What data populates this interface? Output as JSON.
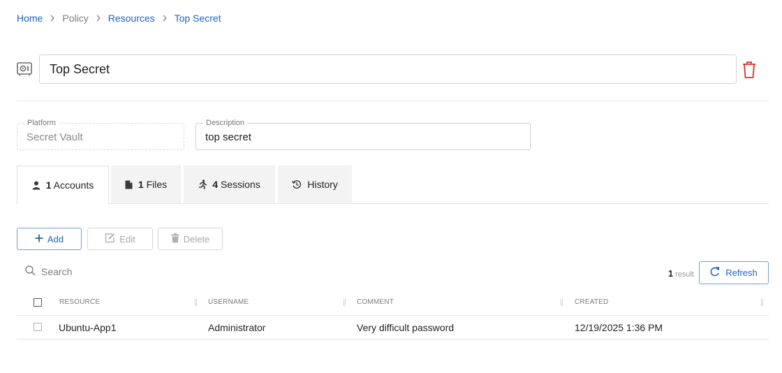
{
  "breadcrumb": {
    "items": [
      "Home",
      "Policy",
      "Resources",
      "Top Secret"
    ]
  },
  "header": {
    "title": "Top Secret",
    "icon": "vault-icon",
    "delete_icon": "trash-icon"
  },
  "fields": {
    "platform": {
      "label": "Platform",
      "value": "Secret Vault"
    },
    "description": {
      "label": "Description",
      "value": "top secret"
    }
  },
  "tabs": [
    {
      "count": "1",
      "label": "Accounts",
      "icon": "user-icon",
      "active": true
    },
    {
      "count": "1",
      "label": "Files",
      "icon": "file-icon",
      "active": false
    },
    {
      "count": "4",
      "label": "Sessions",
      "icon": "running-person-icon",
      "active": false
    },
    {
      "count": "",
      "label": "History",
      "icon": "history-icon",
      "active": false
    }
  ],
  "toolbar": {
    "add_label": "Add",
    "edit_label": "Edit",
    "delete_label": "Delete"
  },
  "search": {
    "placeholder": "Search"
  },
  "results": {
    "count": "1",
    "label": "result",
    "refresh_label": "Refresh"
  },
  "table": {
    "columns": [
      "RESOURCE",
      "USERNAME",
      "COMMENT",
      "CREATED"
    ],
    "rows": [
      [
        "Ubuntu-App1",
        "Administrator",
        "Very difficult password",
        "12/19/2025 1:36 PM"
      ]
    ]
  },
  "colors": {
    "accent": "#1d63c4",
    "danger": "#d93025",
    "muted": "#7d7d7d"
  }
}
